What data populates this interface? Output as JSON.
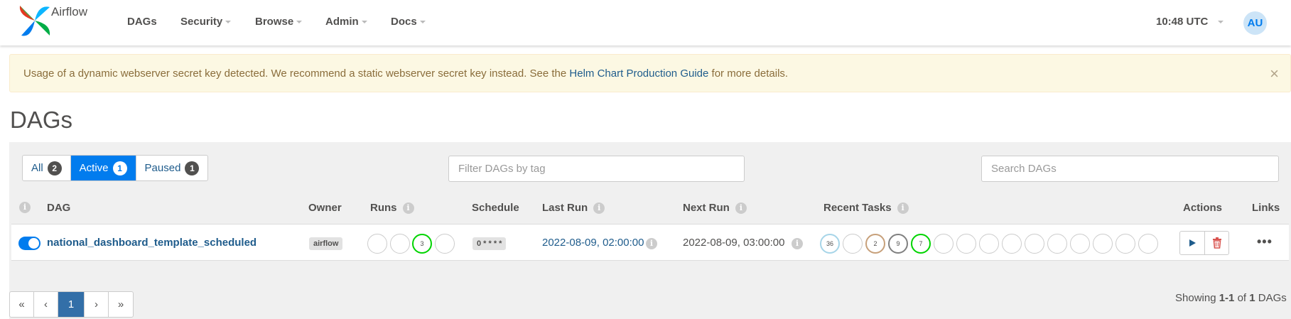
{
  "navbar": {
    "brand": "Airflow",
    "items": [
      {
        "label": "DAGs",
        "dropdown": false
      },
      {
        "label": "Security",
        "dropdown": true
      },
      {
        "label": "Browse",
        "dropdown": true
      },
      {
        "label": "Admin",
        "dropdown": true
      },
      {
        "label": "Docs",
        "dropdown": true
      }
    ],
    "clock": "10:48 UTC",
    "avatar": "AU"
  },
  "alert": {
    "text_before": "Usage of a dynamic webserver secret key detected. We recommend a static webserver secret key instead. See the ",
    "link": "Helm Chart Production Guide",
    "text_after": " for more details.",
    "close": "×"
  },
  "page_title": "DAGs",
  "filters": {
    "status": [
      {
        "label": "All",
        "count": "2"
      },
      {
        "label": "Active",
        "count": "1"
      },
      {
        "label": "Paused",
        "count": "1"
      }
    ],
    "tag_placeholder": "Filter DAGs by tag",
    "search_placeholder": "Search DAGs"
  },
  "table": {
    "headers": {
      "info": "i",
      "dag": "DAG",
      "owner": "Owner",
      "runs": "Runs",
      "schedule": "Schedule",
      "last_run": "Last Run",
      "next_run": "Next Run",
      "recent_tasks": "Recent Tasks",
      "actions": "Actions",
      "links": "Links"
    },
    "rows": [
      {
        "dag_id": "national_dashboard_template_scheduled",
        "owner": "airflow",
        "runs": [
          "",
          "",
          "3",
          ""
        ],
        "schedule": "0 * * * *",
        "last_run": "2022-08-09, 02:00:00",
        "next_run": "2022-08-09, 03:00:00",
        "recent_tasks": [
          "36",
          "",
          "2",
          "9",
          "7",
          "",
          "",
          "",
          "",
          "",
          "",
          "",
          "",
          "",
          ""
        ],
        "links": "•••"
      }
    ]
  },
  "colors": {
    "accent": "#017cee",
    "success": "#00d400",
    "queued": "#808080",
    "upstream_failed": "#c7a07a",
    "scheduled": "#a7d5e8",
    "failed": "#d9534f"
  },
  "pagination": {
    "first": "«",
    "prev": "‹",
    "current": "1",
    "next": "›",
    "last": "»"
  },
  "showing": {
    "prefix": "Showing ",
    "range": "1-1",
    "mid": " of ",
    "total": "1",
    "suffix": " DAGs"
  }
}
